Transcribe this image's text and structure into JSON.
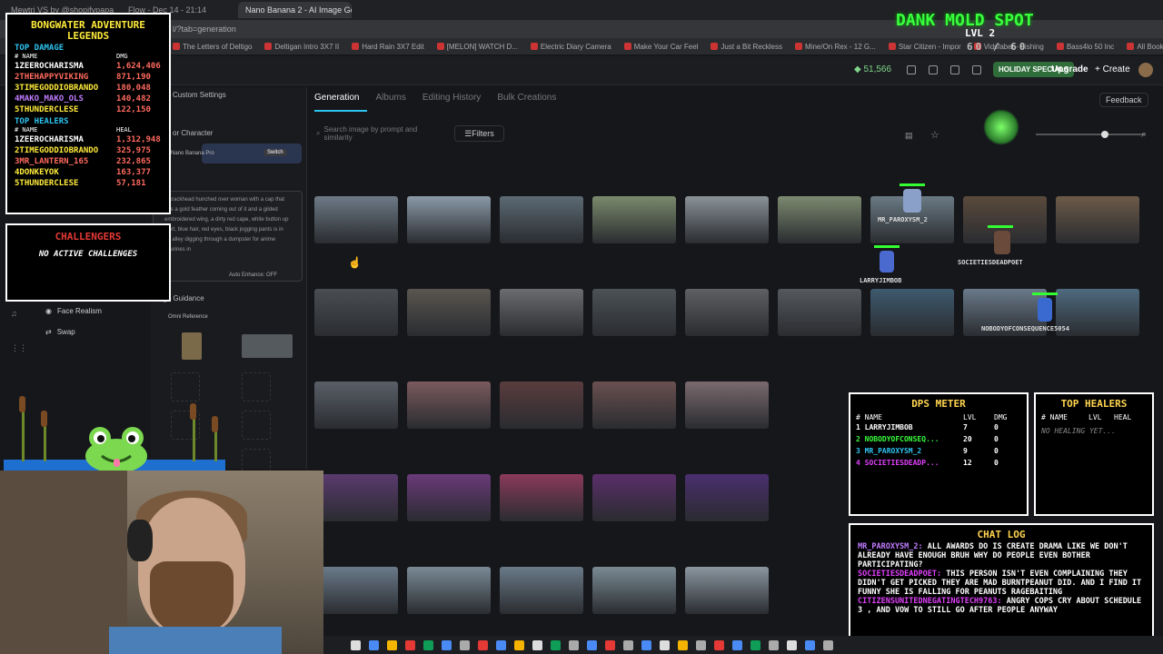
{
  "browser": {
    "tabs": [
      "Mewtri VS by @shopifypapa",
      "Flow - Dec 14 - 21:14",
      "Nano Banana 2 - AI Image Gen"
    ],
    "address": "l/?tab=generation",
    "bookmarks": [
      "The Letters of Deltigo",
      "Deltigan Intro 3X7 II",
      "Hard Rain 3X7 Edit",
      "[MELON] WATCH D...",
      "Electric Diary Camera",
      "Make Your Car Feel",
      "Just a Bit Reckless",
      "Mine/On Rex - 12 G...",
      "Star Citizen - Impor",
      "Vidsfabet - Fishing",
      "Bass4lo 50 Inc",
      "All Bookmarks"
    ]
  },
  "header": {
    "credits": "51,566",
    "holiday": "HOLIDAY SPECIALS",
    "upgrade": "Upgrade",
    "create": "+ Create"
  },
  "tabs": [
    "Generation",
    "Albums",
    "Editing History",
    "Bulk Creations"
  ],
  "feedback": "Feedback",
  "search": {
    "placeholder": "Search image by prompt and similarity"
  },
  "filters": "Filters",
  "panel": {
    "custom_settings": "Custom Settings",
    "model_character": "Model or Character",
    "model_name": "Nano Banana Pro",
    "switch": "Switch",
    "prompt": "a crackhead hunched over woman with a cap that has a gold feather coming out of it and a gilded embroidered wing, a dirty red cape, white button up shirt, blue hair, red eyes, black jogging pants is in an alley digging through a dumpster for anime figurines in",
    "auto_enhance": "Auto Enhance: OFF",
    "image_guidance": "Image Guidance",
    "omni_reference": "Omni Reference"
  },
  "sidenav": [
    {
      "label": "Face Realism"
    },
    {
      "label": "Swap"
    }
  ],
  "legend": {
    "title": "BONGWATER ADVENTURE LEGENDS",
    "top_damage": "TOP DAMAGE",
    "col_name": "# NAME",
    "col_dmg": "DMG",
    "damage": [
      {
        "rank": "1",
        "name": "ZEEROCHARISMA",
        "value": "1,624,406",
        "color": "#ffffff"
      },
      {
        "rank": "2",
        "name": "THEHAPPYVIKING",
        "value": "871,190",
        "color": "#ff6a5e"
      },
      {
        "rank": "3",
        "name": "TIMEGODDIOBRANDO",
        "value": "180,048",
        "color": "#ffeb3b"
      },
      {
        "rank": "4",
        "name": "MAKO_MAKO_OLS",
        "value": "140,482",
        "color": "#c07cff"
      },
      {
        "rank": "5",
        "name": "THUNDERCLESE",
        "value": "122,150",
        "color": "#ffeb3b"
      }
    ],
    "top_healers": "TOP HEALERS",
    "col_heal": "HEAL",
    "healers": [
      {
        "rank": "1",
        "name": "ZEEROCHARISMA",
        "value": "1,312,948",
        "color": "#ffffff"
      },
      {
        "rank": "2",
        "name": "TIMEGODDIOBRANDO",
        "value": "325,975",
        "color": "#ffeb3b"
      },
      {
        "rank": "3",
        "name": "MR_LANTERN_165",
        "value": "232,865",
        "color": "#ff6a5e"
      },
      {
        "rank": "4",
        "name": "DONKEYOK",
        "value": "163,377",
        "color": "#ffeb3b"
      },
      {
        "rank": "5",
        "name": "THUNDERCLESE",
        "value": "57,181",
        "color": "#ffeb3b"
      }
    ]
  },
  "challengers": {
    "title": "CHALLENGERS",
    "sub": "NO ACTIVE CHALLENGES"
  },
  "game": {
    "title": "DANK MOLD SPOT",
    "level": "LVL 2",
    "hp": "60 / 60"
  },
  "dps": {
    "title": "DPS METER",
    "cols": [
      "# NAME",
      "LVL",
      "DMG"
    ],
    "rows": [
      {
        "rank": "1",
        "name": "LARRYJIMBOB",
        "lvl": "7",
        "dmg": "0",
        "color": "#ffffff"
      },
      {
        "rank": "2",
        "name": "NOBODYOFCONSEQ...",
        "lvl": "20",
        "dmg": "0",
        "color": "#39ff3d"
      },
      {
        "rank": "3",
        "name": "MR_PAROXYSM_2",
        "lvl": "9",
        "dmg": "0",
        "color": "#2ec4f0"
      },
      {
        "rank": "4",
        "name": "SOCIETIESDEADP...",
        "lvl": "12",
        "dmg": "0",
        "color": "#e040fb"
      }
    ]
  },
  "tophealers": {
    "title": "TOP HEALERS",
    "cols": [
      "# NAME",
      "LVL",
      "HEAL"
    ],
    "empty": "NO HEALING YET..."
  },
  "chat": {
    "title": "CHAT LOG",
    "messages": [
      {
        "user": "MR_PAROXYSM_2:",
        "text": " ALL AWARDS DO IS CREATE DRAMA LIKE WE DON'T ALREADY HAVE ENOUGH BRUH WHY DO PEOPLE EVEN BOTHER PARTICIPATING?",
        "ucolor": "#c07cff"
      },
      {
        "user": "SOCIETIESDEADPOET:",
        "text": " THIS PERSON ISN'T EVEN COMPLAINING THEY DIDN'T GET PICKED THEY ARE MAD BURNTPEANUT DID. AND I FIND IT FUNNY SHE IS FALLING FOR PEANUTS RAGEBAITING",
        "ucolor": "#e040fb"
      },
      {
        "user": "CITIZENSUNITEDNEGATINGTECH9763:",
        "text": " ANGRY COPS CRY ABOUT SCHEDULE 3 , AND VOW TO STILL GO AFTER PEOPLE ANYWAY",
        "ucolor": "#e040fb"
      }
    ]
  },
  "sprites": [
    {
      "name": "LARRYJIMBOB",
      "color": "#ffeb3b"
    },
    {
      "name": "SOCIETIESDEADPOET",
      "color": "#e040fb"
    },
    {
      "name": "MR_PAROXYSM_2",
      "color": "#2ec4f0"
    },
    {
      "name": "NOBODYOFCONSEQUENCE5054",
      "color": "#39ff3d"
    }
  ],
  "colors": {
    "accent": "#2ec4f0",
    "green": "#39ff3d",
    "panel": "#1a1b1f"
  }
}
